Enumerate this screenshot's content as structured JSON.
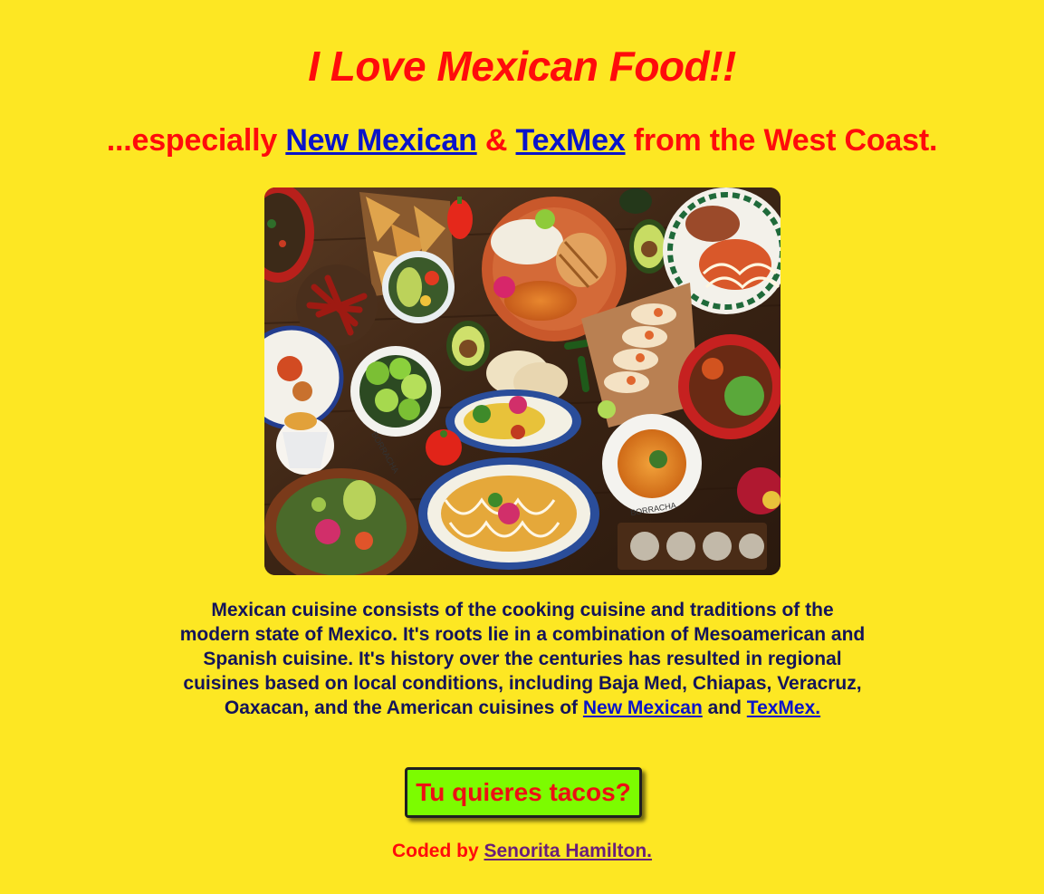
{
  "header": {
    "title": "I Love Mexican Food!!",
    "subtitle_prefix": "...especially ",
    "subtitle_link_1": "New Mexican",
    "subtitle_amp": " & ",
    "subtitle_link_2": "TexMex",
    "subtitle_suffix": " from the West Coast."
  },
  "hero": {
    "alt": "Overhead view of a table full of Mexican dishes",
    "plate_texts": [
      "BORRACHA",
      "BORRACHA"
    ]
  },
  "description": {
    "text": "Mexican cuisine consists of the cooking cuisine and traditions of the modern state of Mexico. It's roots lie in a combination of Mesoamerican and Spanish cuisine. It's history over the centuries has resulted in regional cuisines based on local conditions, including Baja Med, Chiapas, Veracruz, Oaxacan, and the American cuisines of ",
    "link_1": "New Mexican",
    "and": " and ",
    "link_2": "TexMex."
  },
  "cta": {
    "label": "Tu quieres tacos?"
  },
  "footer": {
    "prefix": "Coded by ",
    "author_link": "Senorita Hamilton."
  },
  "colors": {
    "background": "#fde723",
    "title_red": "#ff0b0b",
    "link_blue": "#0a14c9",
    "body_navy": "#14145a",
    "button_green": "#7cfc00",
    "credit_link_purple": "#6a1f7a"
  }
}
